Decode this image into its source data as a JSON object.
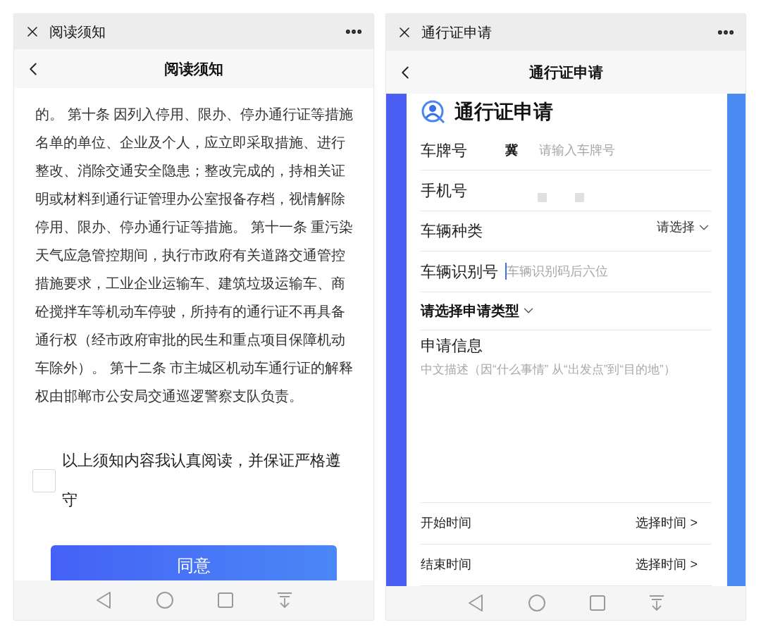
{
  "left_screen": {
    "title_bar": {
      "title": "阅读须知"
    },
    "nav_bar": {
      "title": "阅读须知"
    },
    "notice_text": "的。 第十条 因列入停用、限办、停办通行证等措施名单的单位、企业及个人，应立即采取措施、进行整改、消除交通安全隐患；整改完成的，持相关证明或材料到通行证管理办公室报备存档，视情解除停用、限办、停办通行证等措施。 第十一条 重污染天气应急管控期间，执行市政府有关道路交通管控措施要求，工业企业运输车、建筑垃圾运输车、商砼搅拌车等机动车停驶，所持有的通行证不再具备通行权（经市政府审批的民生和重点项目保障机动车除外）。 第十二条 市主城区机动车通行证的解释权由邯郸市公安局交通巡逻警察支队负责。",
    "agreement": {
      "label": "以上须知内容我认真阅读，并保证严格遵守",
      "checked": false
    },
    "agree_button": "同意"
  },
  "right_screen": {
    "title_bar": {
      "title": "通行证申请"
    },
    "nav_bar": {
      "title": "通行证申请"
    },
    "form": {
      "heading": "通行证申请",
      "fields": [
        {
          "kind": "text",
          "label": "车牌号",
          "prefix": "冀",
          "placeholder": "请输入车牌号",
          "focused": false
        },
        {
          "kind": "masked",
          "label": "手机号"
        },
        {
          "kind": "select",
          "label": "车辆种类",
          "value": "请选择"
        },
        {
          "kind": "text",
          "label": "车辆识别号",
          "placeholder": "车辆识别码后六位",
          "focused": true
        },
        {
          "kind": "dropdown",
          "label": "请选择申请类型"
        },
        {
          "kind": "textarea",
          "label": "申请信息",
          "placeholder": "中文描述（因“什么事情” 从“出发点”到“目的地”）"
        },
        {
          "kind": "time",
          "label": "开始时间",
          "value": "选择时间 >"
        },
        {
          "kind": "time",
          "label": "结束时间",
          "value": "选择时间 >"
        }
      ]
    }
  }
}
